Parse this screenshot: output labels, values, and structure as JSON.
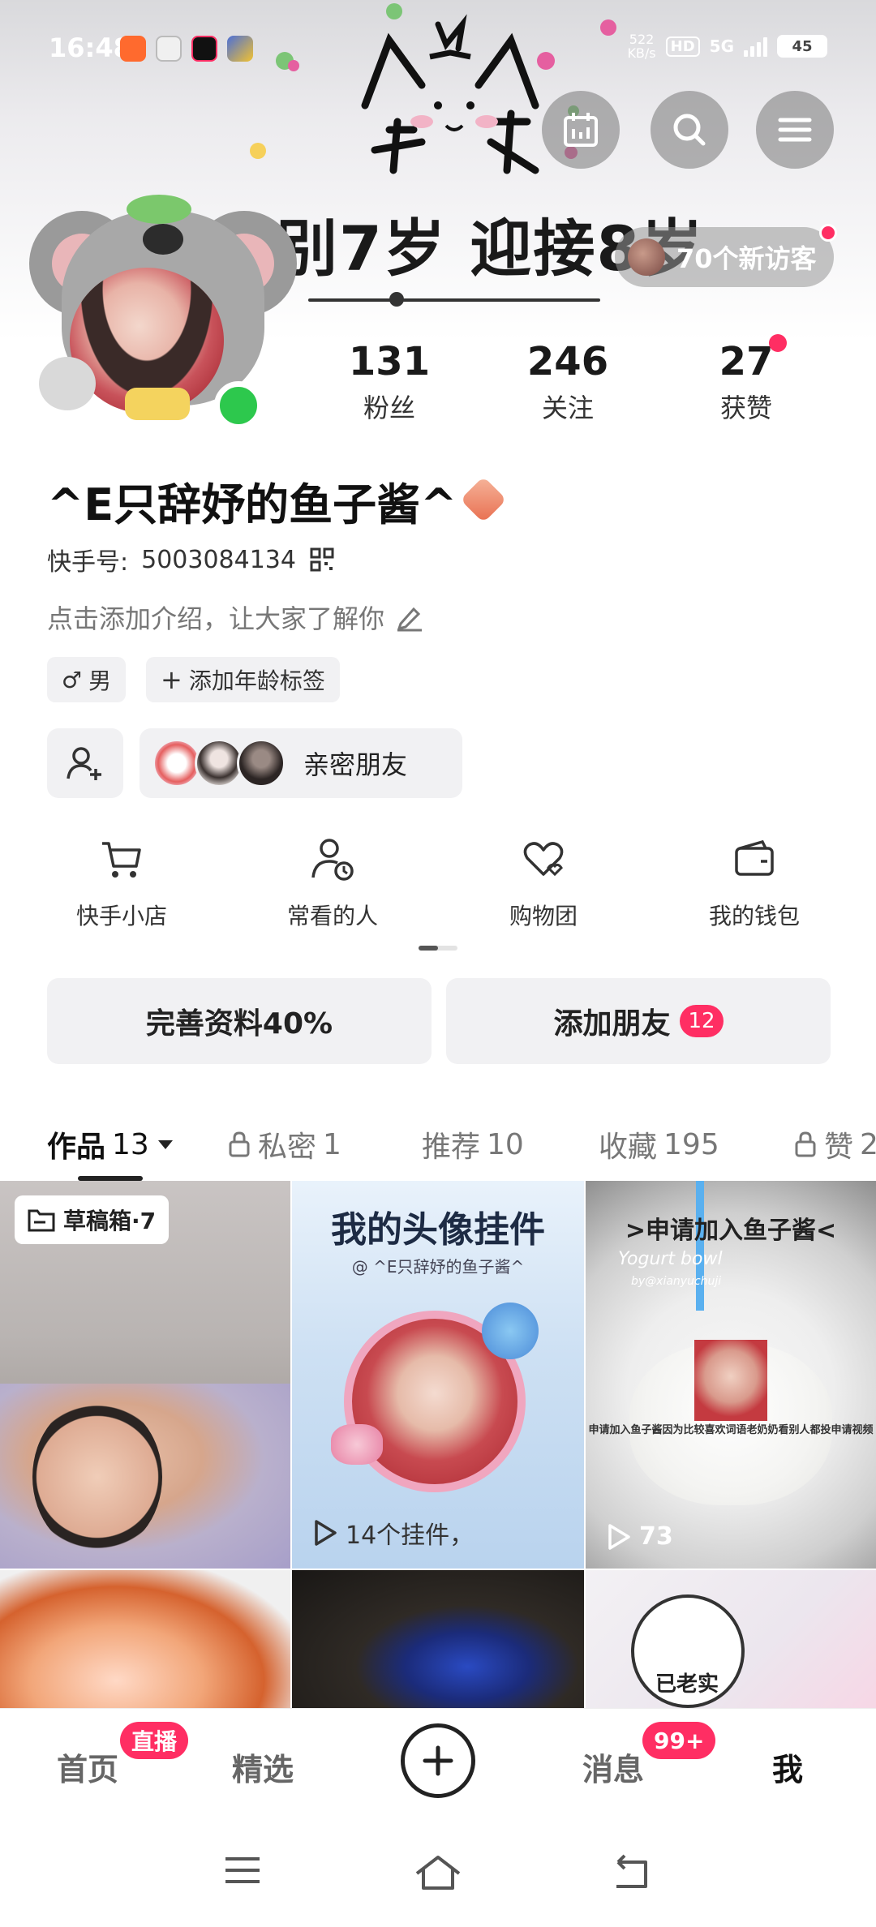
{
  "status_bar": {
    "time": "16:48",
    "net_speed_value": "522",
    "net_speed_unit": "KB/s",
    "hd": "HD",
    "network": "5G",
    "battery": "45"
  },
  "banner": {
    "text": "别7岁  迎接8岁"
  },
  "top_buttons": [
    "calendar-icon",
    "search-icon",
    "menu-icon"
  ],
  "visitors": {
    "label": "70个新访客"
  },
  "stats": [
    {
      "value": "131",
      "label": "粉丝"
    },
    {
      "value": "246",
      "label": "关注"
    },
    {
      "value": "27",
      "label": "获赞"
    }
  ],
  "profile": {
    "name": "^E只辞妤的鱼子酱^",
    "account_label": "快手号:",
    "account_id": "5003084134",
    "bio_placeholder": "点击添加介绍，让大家了解你",
    "gender": "男",
    "gender_symbol": "♂",
    "age_tag": "添加年龄标签",
    "intimate_friends": "亲密朋友"
  },
  "services": [
    {
      "label": "快手小店",
      "icon": "cart-icon"
    },
    {
      "label": "常看的人",
      "icon": "person-clock-icon"
    },
    {
      "label": "购物团",
      "icon": "heart-group-icon"
    },
    {
      "label": "我的钱包",
      "icon": "wallet-icon"
    }
  ],
  "actions": {
    "complete_profile": "完善资料40%",
    "add_friend": "添加朋友",
    "add_friend_count": "12"
  },
  "tabs": [
    {
      "label": "作品",
      "count": "13",
      "locked": false,
      "dropdown": true
    },
    {
      "label": "私密",
      "count": "1",
      "locked": true
    },
    {
      "label": "推荐",
      "count": "10",
      "locked": false
    },
    {
      "label": "收藏",
      "count": "195",
      "locked": false
    },
    {
      "label": "赞",
      "count": "2",
      "locked": true
    }
  ],
  "grid": {
    "draft_label": "草稿箱·7",
    "card2_title": "我的头像挂件",
    "card2_subtitle": "@ ^E只辞妤的鱼子酱^",
    "card2_caption": "14个挂件，",
    "card2_count": "14个挂件，",
    "card3_title": ">申请加入鱼子酱<",
    "card3_brand": "Yogurt bowl",
    "card3_sub": "by@xianyuchuji",
    "card3_caption": "申请加入鱼子酱因为比较喜欢词语老奶奶看别人都投申请视频",
    "card3_count": "73",
    "card6_text": "已老实"
  },
  "bottom_nav": {
    "home": "首页",
    "home_badge": "直播",
    "featured": "精选",
    "messages": "消息",
    "messages_badge": "99+",
    "me": "我"
  },
  "colors": {
    "accent": "#ff2e63",
    "online": "#2dc84d",
    "pill_bg": "#f1f1f3"
  }
}
